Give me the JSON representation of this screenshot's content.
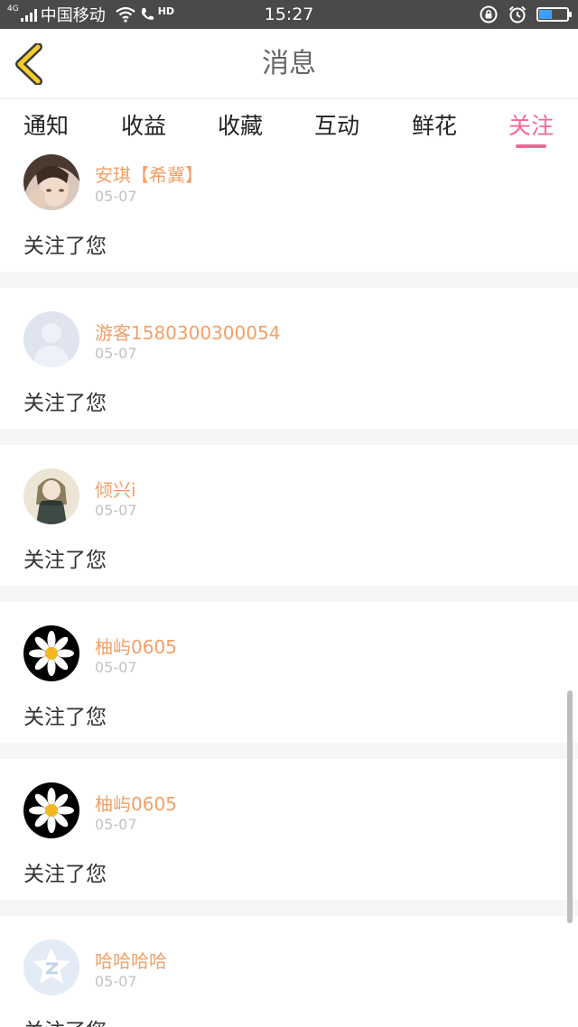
{
  "status_bar": {
    "network_type": "4G",
    "carrier": "中国移动",
    "hd_badge": "HD",
    "time": "15:27",
    "battery_level": 0.45,
    "icons": [
      "signal-icon",
      "wifi-icon",
      "volte-call-icon",
      "rotation-lock-icon",
      "alarm-icon",
      "battery-icon"
    ]
  },
  "nav": {
    "title": "消息",
    "back_icon": "chevron-left-icon"
  },
  "tabs": [
    {
      "label": "通知",
      "active": false
    },
    {
      "label": "收益",
      "active": false
    },
    {
      "label": "收藏",
      "active": false
    },
    {
      "label": "互动",
      "active": false
    },
    {
      "label": "鲜花",
      "active": false
    },
    {
      "label": "关注",
      "active": true
    }
  ],
  "colors": {
    "accent": "#f0689b",
    "username": "#f2a067",
    "date": "#c2c2c2",
    "status_bar": "#4a4a4a"
  },
  "items": [
    {
      "username": "安琪【希冀】",
      "date": "05-07",
      "message": "关注了您",
      "avatar": "photo-avatar-girl"
    },
    {
      "username": "游客1580300300054",
      "date": "05-07",
      "message": "关注了您",
      "avatar": "default-user-avatar"
    },
    {
      "username": "倾兴i",
      "date": "05-07",
      "message": "关注了您",
      "avatar": "anime-girl-avatar"
    },
    {
      "username": "柚屿0605",
      "date": "05-07",
      "message": "关注了您",
      "avatar": "daisy-avatar"
    },
    {
      "username": "柚屿0605",
      "date": "05-07",
      "message": "关注了您",
      "avatar": "daisy-avatar"
    },
    {
      "username": "哈哈哈哈",
      "date": "05-07",
      "message": "关注了您",
      "avatar": "qq-avatar"
    }
  ]
}
